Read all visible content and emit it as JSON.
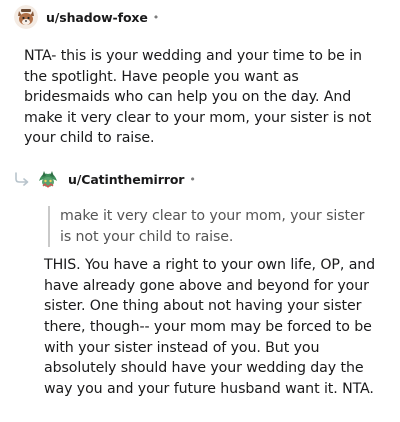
{
  "comments": [
    {
      "username": "u/shadow-foxe",
      "separator": "•",
      "avatar_icon": "fox-avatar-icon",
      "body": "NTA- this is your wedding and your time to be in the spotlight. Have people you want as bridesmaids who can help you on the day. And make it very clear to your mom, your sister is not your child to raise."
    },
    {
      "username": "u/Catinthemirror",
      "separator": "•",
      "avatar_icon": "cat-avatar-icon",
      "reply_icon": "reply-arrow-icon",
      "quote": "make it very clear to your mom, your sister is not your child to raise.",
      "body": "THIS. You have a right to your own life, OP, and have already gone above and beyond for your sister. One thing about not having your sister there, though-- your mom may be forced to be with your sister instead of you. But you absolutely should have your wedding day the way you and your future husband want it. NTA."
    }
  ],
  "colors": {
    "text": "#1a1a1b",
    "muted": "#7c7c7c",
    "quote_text": "#555555",
    "quote_border": "#c9c9c9"
  }
}
